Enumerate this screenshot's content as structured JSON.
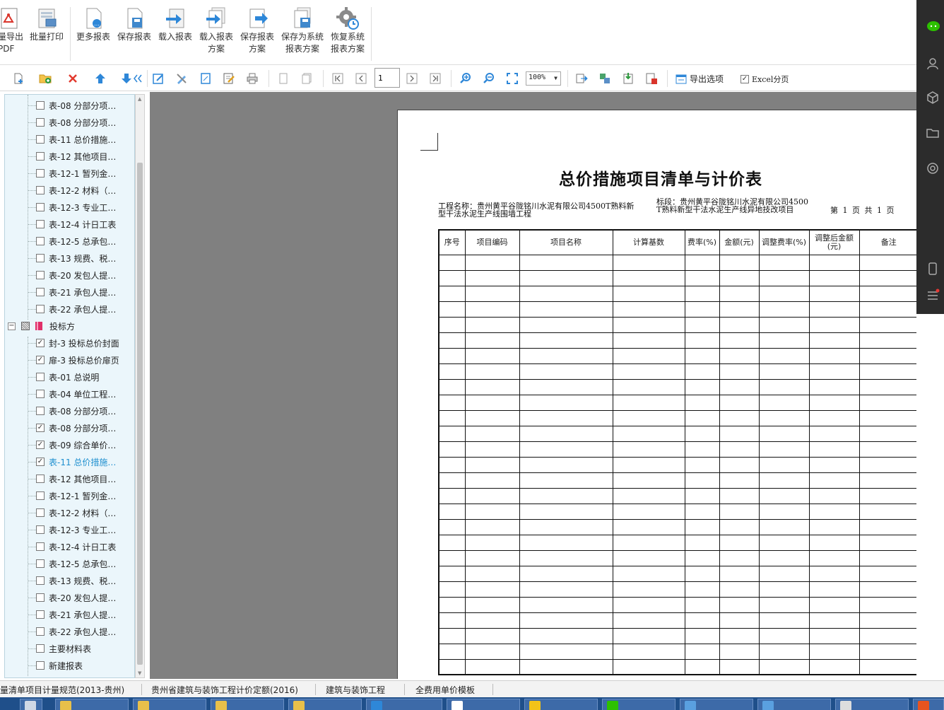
{
  "ribbon": {
    "buttons": [
      {
        "label": "量导出\nPDF",
        "icon": "pdf-icon"
      },
      {
        "label": "批量打印",
        "icon": "batch-print-icon"
      },
      {
        "label": "更多报表",
        "icon": "more-reports-icon"
      },
      {
        "label": "保存报表",
        "icon": "save-report-icon"
      },
      {
        "label": "载入报表",
        "icon": "load-report-icon"
      },
      {
        "label": "载入报表\n方案",
        "icon": "load-scheme-icon"
      },
      {
        "label": "保存报表\n方案",
        "icon": "save-scheme-icon"
      },
      {
        "label": "保存为系统\n报表方案",
        "icon": "save-system-scheme-icon"
      },
      {
        "label": "恢复系统\n报表方案",
        "icon": "restore-system-scheme-icon"
      }
    ]
  },
  "toolbar": {
    "page_value": "1",
    "zoom_value": "100%",
    "export_options_label": "导出选项",
    "excel_paging_label": "Excel分页"
  },
  "tree": {
    "items": [
      {
        "label": "表-08 分部分项…",
        "checked": false
      },
      {
        "label": "表-08 分部分项…",
        "checked": false
      },
      {
        "label": "表-11 总价措施…",
        "checked": false
      },
      {
        "label": "表-12 其他项目…",
        "checked": false
      },
      {
        "label": "表-12-1 暂列金…",
        "checked": false
      },
      {
        "label": "表-12-2 材料（…",
        "checked": false
      },
      {
        "label": "表-12-3 专业工…",
        "checked": false
      },
      {
        "label": "表-12-4 计日工表",
        "checked": false
      },
      {
        "label": "表-12-5 总承包…",
        "checked": false
      },
      {
        "label": "表-13 规费、税…",
        "checked": false
      },
      {
        "label": "表-20 发包人提…",
        "checked": false
      },
      {
        "label": "表-21 承包人提…",
        "checked": false
      },
      {
        "label": "表-22 承包人提…",
        "checked": false
      }
    ],
    "parent_label": "投标方",
    "children": [
      {
        "label": "封-3 投标总价封面",
        "checked": true
      },
      {
        "label": "扉-3 投标总价扉页",
        "checked": true
      },
      {
        "label": "表-01 总说明",
        "checked": false
      },
      {
        "label": "表-04 单位工程…",
        "checked": false
      },
      {
        "label": "表-08 分部分项…",
        "checked": false
      },
      {
        "label": "表-08 分部分项…",
        "checked": true
      },
      {
        "label": "表-09 综合单价…",
        "checked": true
      },
      {
        "label": "表-11 总价措施…",
        "checked": true,
        "selected": true
      },
      {
        "label": "表-12 其他项目…",
        "checked": false
      },
      {
        "label": "表-12-1 暂列金…",
        "checked": false
      },
      {
        "label": "表-12-2 材料（…",
        "checked": false
      },
      {
        "label": "表-12-3 专业工…",
        "checked": false
      },
      {
        "label": "表-12-4 计日工表",
        "checked": false
      },
      {
        "label": "表-12-5 总承包…",
        "checked": false
      },
      {
        "label": "表-13 规费、税…",
        "checked": false
      },
      {
        "label": "表-20 发包人提…",
        "checked": false
      },
      {
        "label": "表-21 承包人提…",
        "checked": false
      },
      {
        "label": "表-22 承包人提…",
        "checked": false
      },
      {
        "label": "主要材料表",
        "checked": false
      },
      {
        "label": "新建报表",
        "checked": false
      }
    ]
  },
  "report": {
    "title": "总价措施项目清单与计价表",
    "project_line1": "工程名称：贵州黄平谷陇铭川水泥有限公司4500T熟料新",
    "project_line2": "型干法水泥生产线围墙工程",
    "section_line1": "标段：贵州黄平谷陇铭川水泥有限公司4500",
    "section_line2": "T熟料新型干法水泥生产线异地技改项目",
    "page_info": "第 1 页 共 1 页",
    "columns": [
      "序号",
      "项目编码",
      "项目名称",
      "计算基数",
      "费率(%)",
      "金额(元)",
      "调整费率(%)",
      "调整后金额(元)",
      "备注"
    ]
  },
  "bottom_tabs": [
    "量清单项目计量规范(2013-贵州)",
    "贵州省建筑与装饰工程计价定额(2016)",
    "建筑与装饰工程",
    "全费用单价模板"
  ],
  "colors": {
    "accent": "#1e8fcf",
    "tree_bg": "#ebf6fb",
    "preview_bg": "#808080",
    "taskbar": "#1f4f8a"
  }
}
